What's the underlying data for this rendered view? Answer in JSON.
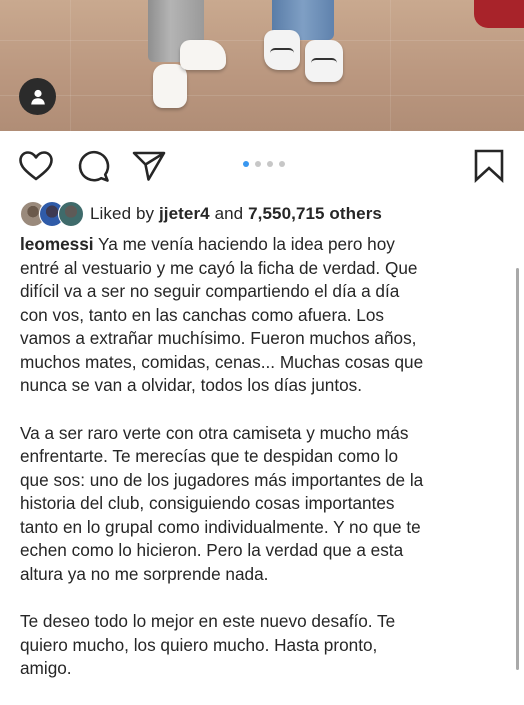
{
  "post": {
    "photo_alt": "post-photo",
    "carousel": {
      "total": 4,
      "active_index": 0
    },
    "likes": {
      "prefix": "Liked by",
      "user": "jjeter4",
      "connector": "and",
      "count": "7,550,715 others"
    },
    "caption": {
      "username": "leomessi",
      "paragraph1": " Ya me venía haciendo la idea pero hoy\nentré al vestuario y me cayó la ficha de verdad. Que\ndifícil va a ser no seguir compartiendo el día a día\ncon vos, tanto en las canchas como afuera. Los\nvamos a extrañar muchísimo. Fueron muchos años,\nmuchos mates, comidas, cenas... Muchas cosas que\nnunca se van a olvidar, todos los días juntos.",
      "paragraph2": "Va a ser raro verte con otra camiseta y mucho más\nenfrentarte. Te merecías que te despidan como lo\nque sos: uno de los jugadores más importantes de la\nhistoria del club, consiguiendo cosas importantes\ntanto en lo grupal como individualmente. Y no que te\nechen como lo hicieron. Pero la verdad que a esta\naltura ya no me sorprende nada.",
      "paragraph3": "Te deseo todo lo mejor en este nuevo desafío. Te\nquiero mucho, los quiero mucho. Hasta pronto,\namigo."
    }
  },
  "icons": [
    "user-tag-icon",
    "heart-icon",
    "comment-icon",
    "share-icon",
    "bookmark-icon"
  ],
  "colors": {
    "accent": "#3897f0",
    "text": "#262626",
    "dot_inactive": "#c7c7c7"
  }
}
